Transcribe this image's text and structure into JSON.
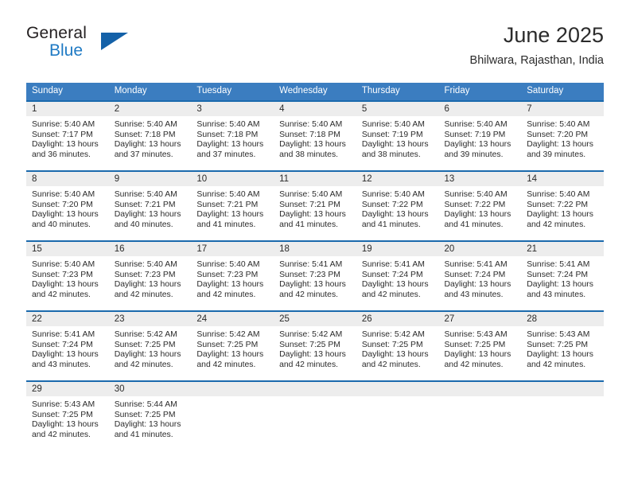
{
  "brand": {
    "word1": "General",
    "word2": "Blue",
    "triangle_icon": "triangle-icon",
    "color_dark": "#231f20",
    "color_blue": "#1f7ac4",
    "triangle_color": "#1461a8"
  },
  "header": {
    "title": "June 2025",
    "location": "Bhilwara, Rajasthan, India"
  },
  "theme": {
    "header_row_bg": "#3b7dc0",
    "row_divider": "#1b6aad",
    "daynum_band_bg": "#ededed",
    "text": "#2b2b2b"
  },
  "calendar": {
    "weekday_headers": [
      "Sunday",
      "Monday",
      "Tuesday",
      "Wednesday",
      "Thursday",
      "Friday",
      "Saturday"
    ],
    "weeks": [
      [
        {
          "day": "1",
          "sunrise": "Sunrise: 5:40 AM",
          "sunset": "Sunset: 7:17 PM",
          "daylight1": "Daylight: 13 hours",
          "daylight2": "and 36 minutes."
        },
        {
          "day": "2",
          "sunrise": "Sunrise: 5:40 AM",
          "sunset": "Sunset: 7:18 PM",
          "daylight1": "Daylight: 13 hours",
          "daylight2": "and 37 minutes."
        },
        {
          "day": "3",
          "sunrise": "Sunrise: 5:40 AM",
          "sunset": "Sunset: 7:18 PM",
          "daylight1": "Daylight: 13 hours",
          "daylight2": "and 37 minutes."
        },
        {
          "day": "4",
          "sunrise": "Sunrise: 5:40 AM",
          "sunset": "Sunset: 7:18 PM",
          "daylight1": "Daylight: 13 hours",
          "daylight2": "and 38 minutes."
        },
        {
          "day": "5",
          "sunrise": "Sunrise: 5:40 AM",
          "sunset": "Sunset: 7:19 PM",
          "daylight1": "Daylight: 13 hours",
          "daylight2": "and 38 minutes."
        },
        {
          "day": "6",
          "sunrise": "Sunrise: 5:40 AM",
          "sunset": "Sunset: 7:19 PM",
          "daylight1": "Daylight: 13 hours",
          "daylight2": "and 39 minutes."
        },
        {
          "day": "7",
          "sunrise": "Sunrise: 5:40 AM",
          "sunset": "Sunset: 7:20 PM",
          "daylight1": "Daylight: 13 hours",
          "daylight2": "and 39 minutes."
        }
      ],
      [
        {
          "day": "8",
          "sunrise": "Sunrise: 5:40 AM",
          "sunset": "Sunset: 7:20 PM",
          "daylight1": "Daylight: 13 hours",
          "daylight2": "and 40 minutes."
        },
        {
          "day": "9",
          "sunrise": "Sunrise: 5:40 AM",
          "sunset": "Sunset: 7:21 PM",
          "daylight1": "Daylight: 13 hours",
          "daylight2": "and 40 minutes."
        },
        {
          "day": "10",
          "sunrise": "Sunrise: 5:40 AM",
          "sunset": "Sunset: 7:21 PM",
          "daylight1": "Daylight: 13 hours",
          "daylight2": "and 41 minutes."
        },
        {
          "day": "11",
          "sunrise": "Sunrise: 5:40 AM",
          "sunset": "Sunset: 7:21 PM",
          "daylight1": "Daylight: 13 hours",
          "daylight2": "and 41 minutes."
        },
        {
          "day": "12",
          "sunrise": "Sunrise: 5:40 AM",
          "sunset": "Sunset: 7:22 PM",
          "daylight1": "Daylight: 13 hours",
          "daylight2": "and 41 minutes."
        },
        {
          "day": "13",
          "sunrise": "Sunrise: 5:40 AM",
          "sunset": "Sunset: 7:22 PM",
          "daylight1": "Daylight: 13 hours",
          "daylight2": "and 41 minutes."
        },
        {
          "day": "14",
          "sunrise": "Sunrise: 5:40 AM",
          "sunset": "Sunset: 7:22 PM",
          "daylight1": "Daylight: 13 hours",
          "daylight2": "and 42 minutes."
        }
      ],
      [
        {
          "day": "15",
          "sunrise": "Sunrise: 5:40 AM",
          "sunset": "Sunset: 7:23 PM",
          "daylight1": "Daylight: 13 hours",
          "daylight2": "and 42 minutes."
        },
        {
          "day": "16",
          "sunrise": "Sunrise: 5:40 AM",
          "sunset": "Sunset: 7:23 PM",
          "daylight1": "Daylight: 13 hours",
          "daylight2": "and 42 minutes."
        },
        {
          "day": "17",
          "sunrise": "Sunrise: 5:40 AM",
          "sunset": "Sunset: 7:23 PM",
          "daylight1": "Daylight: 13 hours",
          "daylight2": "and 42 minutes."
        },
        {
          "day": "18",
          "sunrise": "Sunrise: 5:41 AM",
          "sunset": "Sunset: 7:23 PM",
          "daylight1": "Daylight: 13 hours",
          "daylight2": "and 42 minutes."
        },
        {
          "day": "19",
          "sunrise": "Sunrise: 5:41 AM",
          "sunset": "Sunset: 7:24 PM",
          "daylight1": "Daylight: 13 hours",
          "daylight2": "and 42 minutes."
        },
        {
          "day": "20",
          "sunrise": "Sunrise: 5:41 AM",
          "sunset": "Sunset: 7:24 PM",
          "daylight1": "Daylight: 13 hours",
          "daylight2": "and 43 minutes."
        },
        {
          "day": "21",
          "sunrise": "Sunrise: 5:41 AM",
          "sunset": "Sunset: 7:24 PM",
          "daylight1": "Daylight: 13 hours",
          "daylight2": "and 43 minutes."
        }
      ],
      [
        {
          "day": "22",
          "sunrise": "Sunrise: 5:41 AM",
          "sunset": "Sunset: 7:24 PM",
          "daylight1": "Daylight: 13 hours",
          "daylight2": "and 43 minutes."
        },
        {
          "day": "23",
          "sunrise": "Sunrise: 5:42 AM",
          "sunset": "Sunset: 7:25 PM",
          "daylight1": "Daylight: 13 hours",
          "daylight2": "and 42 minutes."
        },
        {
          "day": "24",
          "sunrise": "Sunrise: 5:42 AM",
          "sunset": "Sunset: 7:25 PM",
          "daylight1": "Daylight: 13 hours",
          "daylight2": "and 42 minutes."
        },
        {
          "day": "25",
          "sunrise": "Sunrise: 5:42 AM",
          "sunset": "Sunset: 7:25 PM",
          "daylight1": "Daylight: 13 hours",
          "daylight2": "and 42 minutes."
        },
        {
          "day": "26",
          "sunrise": "Sunrise: 5:42 AM",
          "sunset": "Sunset: 7:25 PM",
          "daylight1": "Daylight: 13 hours",
          "daylight2": "and 42 minutes."
        },
        {
          "day": "27",
          "sunrise": "Sunrise: 5:43 AM",
          "sunset": "Sunset: 7:25 PM",
          "daylight1": "Daylight: 13 hours",
          "daylight2": "and 42 minutes."
        },
        {
          "day": "28",
          "sunrise": "Sunrise: 5:43 AM",
          "sunset": "Sunset: 7:25 PM",
          "daylight1": "Daylight: 13 hours",
          "daylight2": "and 42 minutes."
        }
      ],
      [
        {
          "day": "29",
          "sunrise": "Sunrise: 5:43 AM",
          "sunset": "Sunset: 7:25 PM",
          "daylight1": "Daylight: 13 hours",
          "daylight2": "and 42 minutes."
        },
        {
          "day": "30",
          "sunrise": "Sunrise: 5:44 AM",
          "sunset": "Sunset: 7:25 PM",
          "daylight1": "Daylight: 13 hours",
          "daylight2": "and 41 minutes."
        },
        {
          "day": "",
          "sunrise": "",
          "sunset": "",
          "daylight1": "",
          "daylight2": ""
        },
        {
          "day": "",
          "sunrise": "",
          "sunset": "",
          "daylight1": "",
          "daylight2": ""
        },
        {
          "day": "",
          "sunrise": "",
          "sunset": "",
          "daylight1": "",
          "daylight2": ""
        },
        {
          "day": "",
          "sunrise": "",
          "sunset": "",
          "daylight1": "",
          "daylight2": ""
        },
        {
          "day": "",
          "sunrise": "",
          "sunset": "",
          "daylight1": "",
          "daylight2": ""
        }
      ]
    ]
  }
}
